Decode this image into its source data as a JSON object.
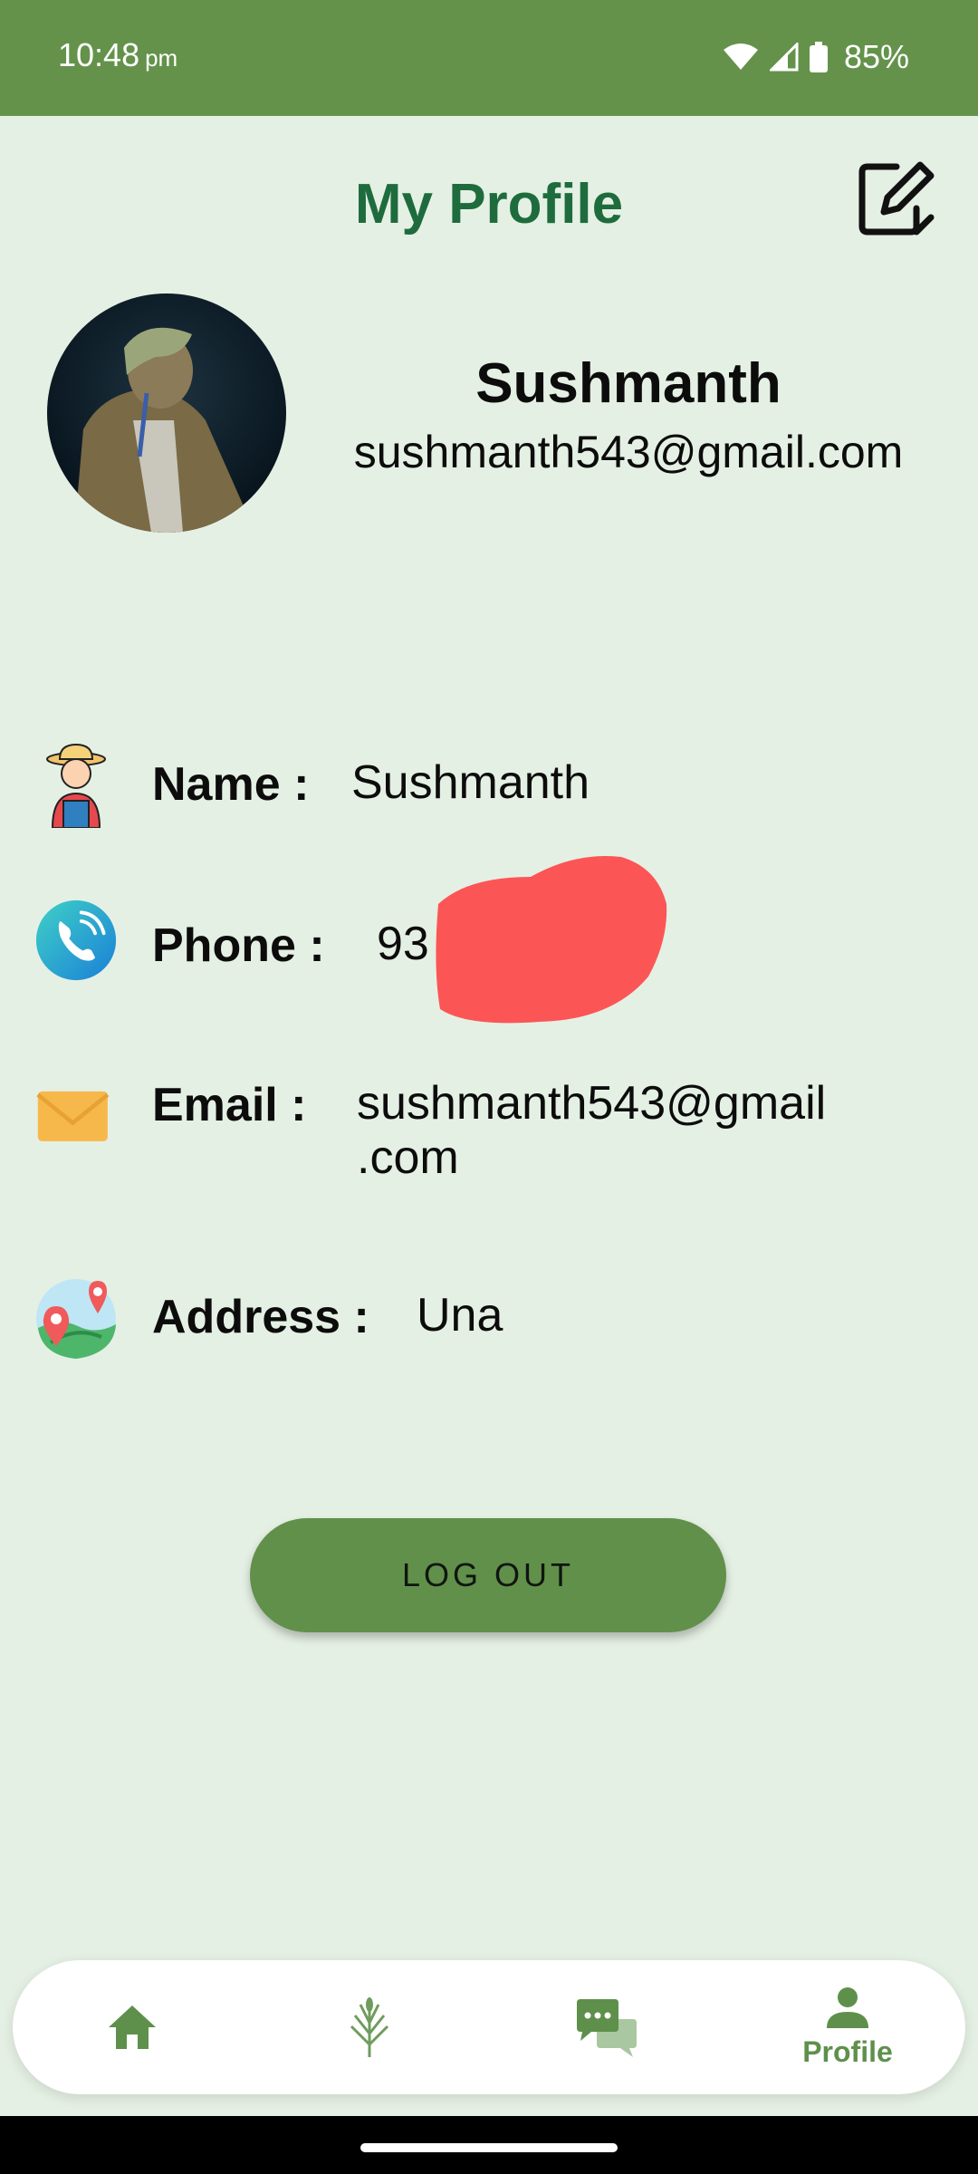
{
  "status_bar": {
    "time": "10:48",
    "ampm": "pm",
    "battery": "85%"
  },
  "header": {
    "title": "My Profile",
    "edit_icon": "edit-icon"
  },
  "profile": {
    "name": "Sushmanth",
    "email": "sushmanth543@gmail.com"
  },
  "details": {
    "name_label": "Name :",
    "name_value": "Sushmanth",
    "phone_label": "Phone :",
    "phone_value": "93",
    "email_label": "Email :",
    "email_value_line1": "sushmanth543@gmail",
    "email_value_line2": ".com",
    "address_label": "Address :",
    "address_value": "Una"
  },
  "logout_label": "LOG OUT",
  "bottom_nav": {
    "items": [
      {
        "icon": "home-icon",
        "label": ""
      },
      {
        "icon": "crop-icon",
        "label": ""
      },
      {
        "icon": "chat-icon",
        "label": ""
      },
      {
        "icon": "profile-icon",
        "label": "Profile"
      }
    ],
    "active_color": "#5e904c"
  },
  "colors": {
    "status_bar": "#64924b",
    "background": "#e5f0e4",
    "title": "#1e6c3d",
    "button": "#61904a"
  }
}
